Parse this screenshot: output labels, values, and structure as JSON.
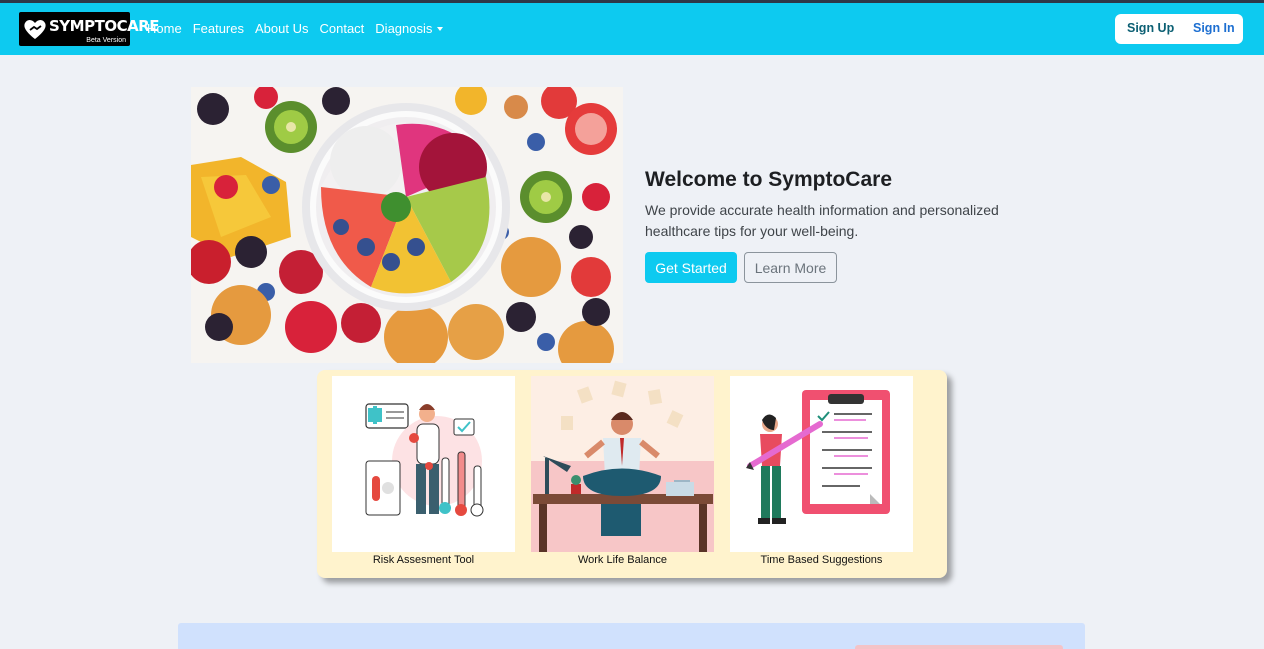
{
  "brand": {
    "name": "SYMPTOCARE",
    "tagline": "Beta Version"
  },
  "nav": {
    "items": [
      {
        "label": "Home"
      },
      {
        "label": "Features"
      },
      {
        "label": "About Us"
      },
      {
        "label": "Contact"
      },
      {
        "label": "Diagnosis"
      }
    ]
  },
  "auth": {
    "signup": "Sign Up",
    "signin": "Sign In"
  },
  "hero": {
    "title": "Welcome to SymptoCare",
    "text": "We provide accurate health information and personalized healthcare tips for your well-being.",
    "primary": "Get Started",
    "secondary": "Learn More"
  },
  "features": [
    {
      "label": "Risk Assesment Tool"
    },
    {
      "label": "Work Life Balance"
    },
    {
      "label": "Time Based Suggestions"
    }
  ],
  "colors": {
    "accent": "#0dcaf0",
    "panel": "#fff3cd",
    "bottom": "#d0e1fd"
  }
}
